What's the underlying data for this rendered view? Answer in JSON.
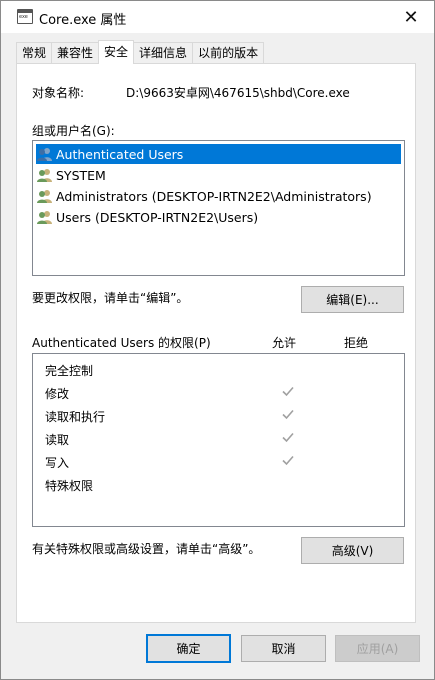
{
  "window": {
    "title": "Core.exe 属性",
    "close_glyph": "✕"
  },
  "tabs": [
    {
      "label": "常规"
    },
    {
      "label": "兼容性"
    },
    {
      "label": "安全",
      "active": true
    },
    {
      "label": "详细信息"
    },
    {
      "label": "以前的版本"
    }
  ],
  "security": {
    "object_name_label": "对象名称:",
    "object_name_value": "D:\\9663安卓网\\467615\\shbd\\Core.exe",
    "groups_label": "组或用户名(G):",
    "users": [
      {
        "name": "Authenticated Users",
        "selected": true
      },
      {
        "name": "SYSTEM"
      },
      {
        "name": "Administrators (DESKTOP-IRTN2E2\\Administrators)"
      },
      {
        "name": "Users (DESKTOP-IRTN2E2\\Users)"
      }
    ],
    "edit_hint": "要更改权限，请单击“编辑”。",
    "edit_button": "编辑(E)...",
    "permissions_label": "Authenticated Users 的权限(P)",
    "allow_header": "允许",
    "deny_header": "拒绝",
    "permissions": [
      {
        "name": "完全控制",
        "allow": false,
        "deny": false
      },
      {
        "name": "修改",
        "allow": true,
        "deny": false
      },
      {
        "name": "读取和执行",
        "allow": true,
        "deny": false
      },
      {
        "name": "读取",
        "allow": true,
        "deny": false
      },
      {
        "name": "写入",
        "allow": true,
        "deny": false
      },
      {
        "name": "特殊权限",
        "allow": false,
        "deny": false
      }
    ],
    "advanced_hint": "有关特殊权限或高级设置，请单击“高级”。",
    "advanced_button": "高级(V)"
  },
  "footer": {
    "ok_button": "确定",
    "cancel_button": "取消",
    "apply_button": "应用(A)"
  },
  "colors": {
    "selection": "#0078d7",
    "check_gray": "#a0a0a0"
  }
}
